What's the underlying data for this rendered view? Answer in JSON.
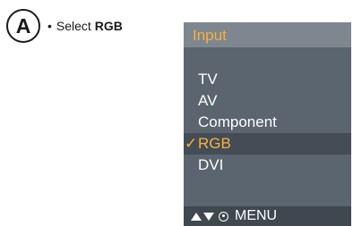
{
  "step": {
    "letter": "A"
  },
  "instruction": {
    "bullet": "•",
    "prefix": "Select ",
    "highlight": "RGB"
  },
  "osd": {
    "title": "Input",
    "items": [
      {
        "label": "TV",
        "selected": false
      },
      {
        "label": "AV",
        "selected": false
      },
      {
        "label": "Component",
        "selected": false
      },
      {
        "label": "RGB",
        "selected": true
      },
      {
        "label": "DVI",
        "selected": false
      }
    ],
    "check_mark": "✓",
    "footer": {
      "nav_icon": "up-down-arrows-icon",
      "ok_icon": "ok-circle-icon",
      "menu_label": "MENU"
    }
  },
  "colors": {
    "panel_bg": "#5b6570",
    "title_bg": "#7e878f",
    "accent": "#f7b23a",
    "footer_bg": "#3f474f"
  }
}
